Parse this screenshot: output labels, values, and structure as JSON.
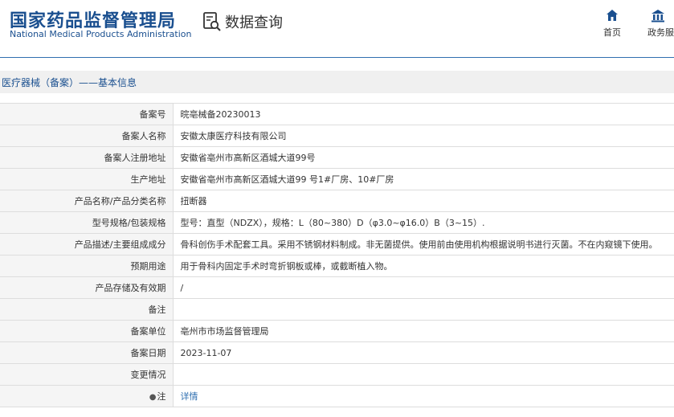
{
  "header": {
    "logo_cn": "国家药品监督管理局",
    "logo_en": "National Medical Products Administration",
    "section_title": "数据查询",
    "section_icon": "search-document-icon",
    "nav": {
      "home_label": "首页",
      "home_icon": "home-icon",
      "gov_label": "政务服",
      "gov_icon": "building-icon"
    }
  },
  "breadcrumb": "医疗器械（备案）——基本信息",
  "colors": {
    "brand": "#1a4f8f",
    "link": "#2f6fb0",
    "label_bg": "#f5f5f5",
    "crumb_bg": "#f0f0f0"
  },
  "rows": [
    {
      "label": "备案号",
      "value": "晥亳械备20230013"
    },
    {
      "label": "备案人名称",
      "value": "安徽太康医疗科技有限公司"
    },
    {
      "label": "备案人注册地址",
      "value": "安徽省亳州市高新区酒城大道99号"
    },
    {
      "label": "生产地址",
      "value": "安徽省亳州市高新区酒城大道99 号1#厂房、10#厂房"
    },
    {
      "label": "产品名称/产品分类名称",
      "value": "扭断器"
    },
    {
      "label": "型号规格/包装规格",
      "value": "型号：直型（NDZX），规格：L（80~380）D（φ3.0~φ16.0）B（3~15）."
    },
    {
      "label": "产品描述/主要组成成分",
      "value": "骨科创伤手术配套工具。采用不锈钢材料制成。非无菌提供。使用前由使用机构根据说明书进行灭菌。不在内窥镜下使用。"
    },
    {
      "label": "预期用途",
      "value": "用于骨科内固定手术时弯折钢板或棒，或截断植入物。"
    },
    {
      "label": "产品存储及有效期",
      "value": "/"
    },
    {
      "label": "备注",
      "value": ""
    },
    {
      "label": "备案单位",
      "value": "亳州市市场监督管理局"
    },
    {
      "label": "备案日期",
      "value": "2023-11-07"
    },
    {
      "label": "变更情况",
      "value": ""
    }
  ],
  "note_row": {
    "label": "注",
    "icon": "pin-icon",
    "link_text": "详情"
  }
}
